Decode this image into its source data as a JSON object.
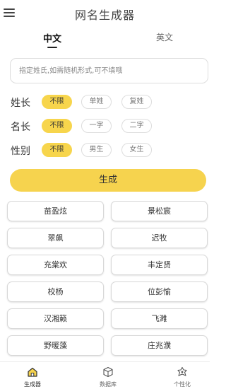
{
  "header": {
    "title": "网名生成器",
    "menu_icon": "hamburger-menu-icon"
  },
  "tabs": [
    {
      "label": "中文",
      "active": true
    },
    {
      "label": "英文",
      "active": false
    }
  ],
  "surname": {
    "value": "",
    "placeholder": "指定姓氏,如需随机形式,可不填哦"
  },
  "options": {
    "surname_length": {
      "label": "姓长",
      "choices": [
        "不限",
        "单姓",
        "复姓"
      ],
      "selected": "不限"
    },
    "name_length": {
      "label": "名长",
      "choices": [
        "不限",
        "一字",
        "二字"
      ],
      "selected": "不限"
    },
    "gender": {
      "label": "性别",
      "choices": [
        "不限",
        "男生",
        "女生"
      ],
      "selected": "不限"
    }
  },
  "generate_label": "生成",
  "results": [
    "苗盈炫",
    "景松宸",
    "翠飙",
    "迟牧",
    "充棠欢",
    "丰定贤",
    "校杨",
    "位彭愉",
    "汉湘籁",
    "飞濉",
    "野暖藻",
    "庄兆濮",
    "",
    ""
  ],
  "bottom_nav": [
    {
      "label": "生成器",
      "icon": "home-icon",
      "active": true
    },
    {
      "label": "数据库",
      "icon": "cube-icon",
      "active": false
    },
    {
      "label": "个性化",
      "icon": "sparkle-badge-icon",
      "active": false
    }
  ],
  "colors": {
    "accent": "#f6d34e",
    "text": "#333333",
    "border": "#d8d8d8"
  }
}
